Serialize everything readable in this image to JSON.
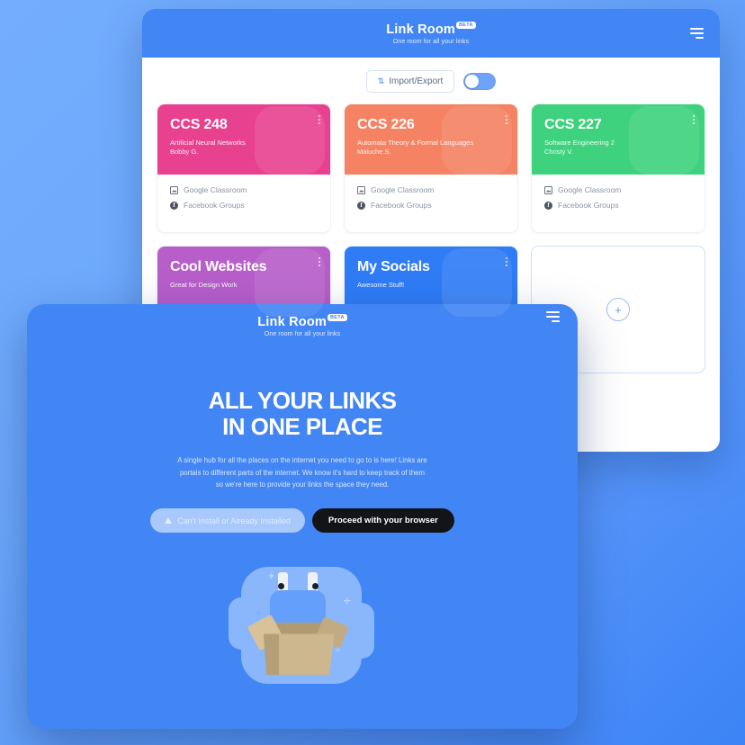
{
  "app": {
    "brand_name": "Link Room",
    "beta_badge": "BETA",
    "tagline": "One room for all your links",
    "menu_icon": "hamburger-menu-icon"
  },
  "toolbar": {
    "import_export_label": "Import/Export",
    "import_export_icon": "import-export-arrows-icon",
    "toggle_state": "off"
  },
  "cards": [
    {
      "title": "CCS 248",
      "subtitle": "Artificial Neural Networks",
      "owner": "Bobby G.",
      "color": "#e8418f",
      "color_dark": "#d6357f",
      "links": [
        {
          "label": "Google Classroom",
          "icon": "google-classroom-icon"
        },
        {
          "label": "Facebook Groups",
          "icon": "facebook-icon"
        }
      ]
    },
    {
      "title": "CCS 226",
      "subtitle": "Automata Theory & Formal Languages",
      "owner": "Maluche S.",
      "color": "#f58263",
      "color_dark": "#ef7455",
      "links": [
        {
          "label": "Google Classroom",
          "icon": "google-classroom-icon"
        },
        {
          "label": "Facebook Groups",
          "icon": "facebook-icon"
        }
      ]
    },
    {
      "title": "CCS 227",
      "subtitle": "Software Engineering 2",
      "owner": "Christy V.",
      "color": "#3ed27e",
      "color_dark": "#33c572",
      "links": [
        {
          "label": "Google Classroom",
          "icon": "google-classroom-icon"
        },
        {
          "label": "Facebook Groups",
          "icon": "facebook-icon"
        }
      ]
    },
    {
      "title": "Cool Websites",
      "subtitle": "Great for Design Work",
      "owner": "",
      "color": "#b75ec9",
      "color_dark": "#a94fbd",
      "links": []
    },
    {
      "title": "My Socials",
      "subtitle": "Awesome Stuff!",
      "owner": "",
      "color": "#2f7cf6",
      "color_dark": "#2970e8",
      "links": []
    }
  ],
  "add_card": {
    "plus_icon": "plus-icon",
    "label": "+"
  },
  "overlay": {
    "brand_name": "Link Room",
    "beta_badge": "BETA",
    "tagline": "One room for all your links",
    "headline_line1": "ALL YOUR LINKS",
    "headline_line2": "IN ONE PLACE",
    "body": "A single hub for all the places on the internet you need to go to is here! Links are portals to different parts of the internet. We know it's hard to keep track of them so we're here to provide your links the space they need.",
    "secondary_button": "Can't Install or Already Installed",
    "secondary_button_icon": "warning-triangle-icon",
    "primary_button": "Proceed with your browser",
    "illustration": "robot-plug-in-box-illustration"
  },
  "theme": {
    "brand_blue": "#4285f4",
    "background_light": "#74adfd",
    "background_dark": "#3c83f6"
  }
}
